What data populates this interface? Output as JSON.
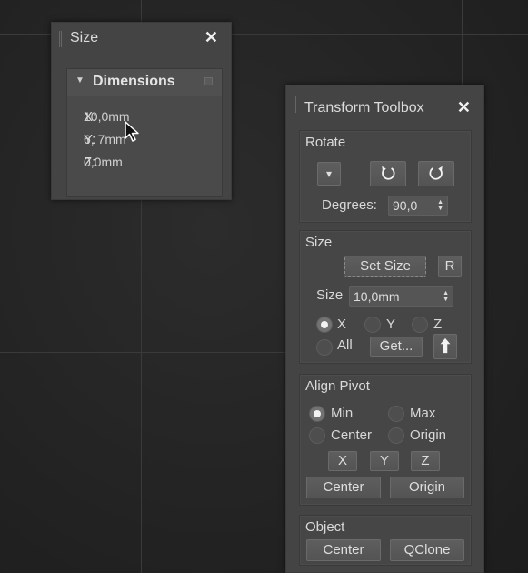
{
  "size_panel": {
    "title": "Size",
    "close": "✕",
    "rollout_title": "Dimensions",
    "rows": [
      {
        "label": "X:",
        "value": "10,0mm"
      },
      {
        "label": "Y:",
        "value": "6,  7mm"
      },
      {
        "label": "Z:",
        "value": "0,0mm"
      }
    ]
  },
  "toolbox": {
    "title": "Transform Toolbox",
    "close": "✕",
    "rotate": {
      "title": "Rotate",
      "dropdown_arrow": "▾",
      "degrees_label": "Degrees:",
      "degrees_value": "90,0"
    },
    "size": {
      "title": "Size",
      "set_size": "Set Size",
      "reset": "R",
      "size_label": "Size",
      "size_value": "10,0mm",
      "axis_x": "X",
      "axis_y": "Y",
      "axis_z": "Z",
      "axis_all": "All",
      "get": "Get...",
      "selected_axis": "X"
    },
    "align_pivot": {
      "title": "Align Pivot",
      "min": "Min",
      "max": "Max",
      "center": "Center",
      "origin": "Origin",
      "x": "X",
      "y": "Y",
      "z": "Z",
      "center_btn": "Center",
      "origin_btn": "Origin",
      "selected": "Min"
    },
    "object": {
      "title": "Object",
      "center": "Center",
      "qclone": "QClone"
    }
  },
  "icons": {
    "close": "close-icon",
    "rotate_ccw": "rotate-ccw-icon",
    "rotate_cw": "rotate-cw-icon",
    "up_arrow": "up-arrow-icon"
  }
}
